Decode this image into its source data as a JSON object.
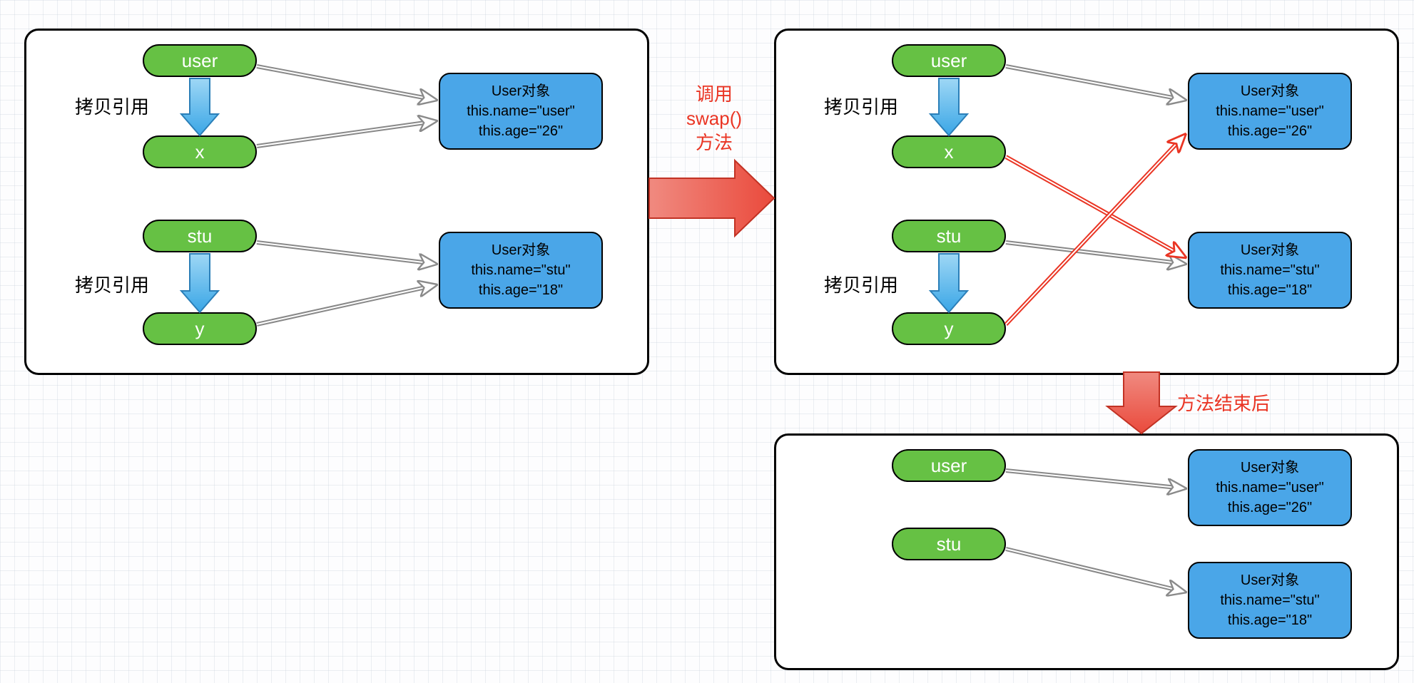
{
  "panel1": {
    "user": "user",
    "x": "x",
    "stu": "stu",
    "y": "y",
    "copy1": "拷贝引用",
    "copy2": "拷贝引用",
    "obj1_l1": "User对象",
    "obj1_l2": "this.name=\"user\"",
    "obj1_l3": "this.age=\"26\"",
    "obj2_l1": "User对象",
    "obj2_l2": "this.name=\"stu\"",
    "obj2_l3": "this.age=\"18\""
  },
  "middle": {
    "call1": "调用",
    "call2": "swap()",
    "call3": "方法"
  },
  "panel2": {
    "user": "user",
    "x": "x",
    "stu": "stu",
    "y": "y",
    "copy1": "拷贝引用",
    "copy2": "拷贝引用",
    "obj1_l1": "User对象",
    "obj1_l2": "this.name=\"user\"",
    "obj1_l3": "this.age=\"26\"",
    "obj2_l1": "User对象",
    "obj2_l2": "this.name=\"stu\"",
    "obj2_l3": "this.age=\"18\""
  },
  "after": "方法结束后",
  "panel3": {
    "user": "user",
    "stu": "stu",
    "obj1_l1": "User对象",
    "obj1_l2": "this.name=\"user\"",
    "obj1_l3": "this.age=\"26\"",
    "obj2_l1": "User对象",
    "obj2_l2": "this.name=\"stu\"",
    "obj2_l3": "this.age=\"18\""
  }
}
